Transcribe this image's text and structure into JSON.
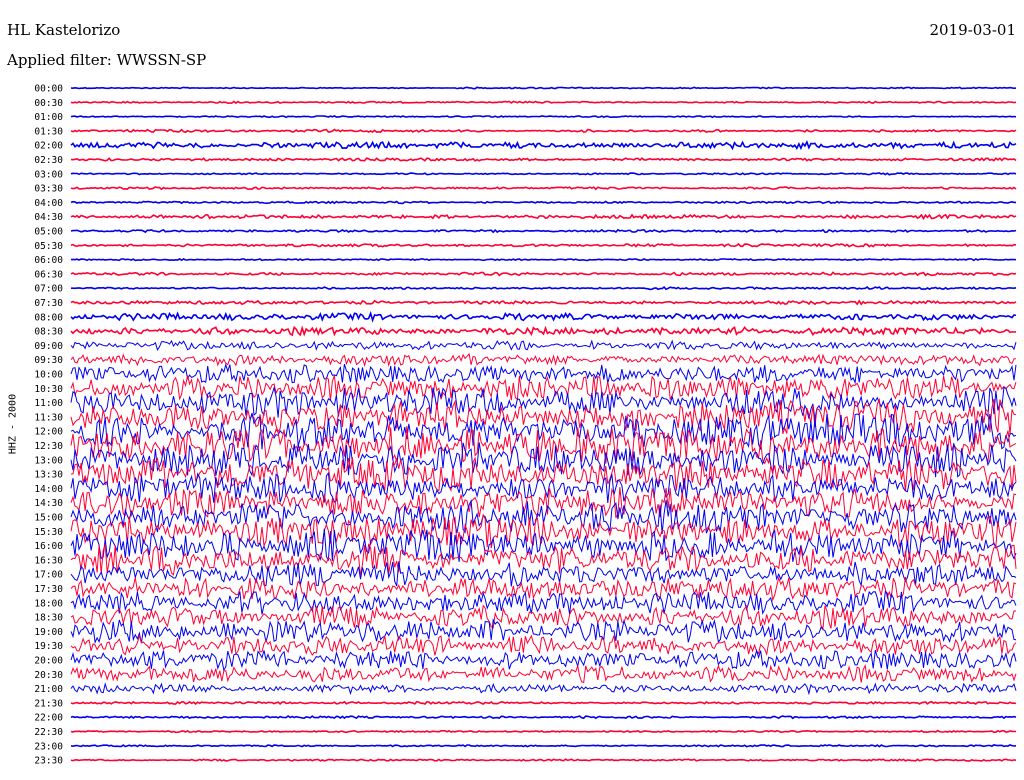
{
  "header": {
    "station": "HL Kastelorizo",
    "date": "2019-03-01",
    "filter": "Applied filter: WWSSN-SP"
  },
  "chart_data": {
    "type": "line",
    "title": "HL Kastelorizo",
    "ylabel": "HHZ - 2000",
    "colors": {
      "odd": "#0000ee",
      "even": "#ff0033"
    },
    "rows": [
      {
        "t": "00:00",
        "amp": 0.5
      },
      {
        "t": "00:30",
        "amp": 0.6
      },
      {
        "t": "01:00",
        "amp": 0.5
      },
      {
        "t": "01:30",
        "amp": 0.9
      },
      {
        "t": "02:00",
        "amp": 2.2
      },
      {
        "t": "02:30",
        "amp": 0.9
      },
      {
        "t": "03:00",
        "amp": 0.6
      },
      {
        "t": "03:30",
        "amp": 0.8
      },
      {
        "t": "04:00",
        "amp": 0.7
      },
      {
        "t": "04:30",
        "amp": 1.3
      },
      {
        "t": "05:00",
        "amp": 0.8
      },
      {
        "t": "05:30",
        "amp": 0.9
      },
      {
        "t": "06:00",
        "amp": 0.6
      },
      {
        "t": "06:30",
        "amp": 1.1
      },
      {
        "t": "07:00",
        "amp": 0.8
      },
      {
        "t": "07:30",
        "amp": 1.2
      },
      {
        "t": "08:00",
        "amp": 2.5
      },
      {
        "t": "08:30",
        "amp": 2.7
      },
      {
        "t": "09:00",
        "amp": 3.2
      },
      {
        "t": "09:30",
        "amp": 4.5
      },
      {
        "t": "10:00",
        "amp": 7
      },
      {
        "t": "10:30",
        "amp": 9
      },
      {
        "t": "11:00",
        "amp": 11
      },
      {
        "t": "11:30",
        "amp": 12
      },
      {
        "t": "12:00",
        "amp": 13
      },
      {
        "t": "12:30",
        "amp": 13
      },
      {
        "t": "13:00",
        "amp": 12
      },
      {
        "t": "13:30",
        "amp": 12
      },
      {
        "t": "14:00",
        "amp": 11
      },
      {
        "t": "14:30",
        "amp": 11
      },
      {
        "t": "15:00",
        "amp": 12
      },
      {
        "t": "15:30",
        "amp": 12
      },
      {
        "t": "16:00",
        "amp": 12
      },
      {
        "t": "16:30",
        "amp": 11
      },
      {
        "t": "17:00",
        "amp": 9
      },
      {
        "t": "17:30",
        "amp": 8
      },
      {
        "t": "18:00",
        "amp": 8
      },
      {
        "t": "18:30",
        "amp": 8
      },
      {
        "t": "19:00",
        "amp": 8
      },
      {
        "t": "19:30",
        "amp": 7
      },
      {
        "t": "20:00",
        "amp": 7
      },
      {
        "t": "20:30",
        "amp": 6
      },
      {
        "t": "21:00",
        "amp": 3.5
      },
      {
        "t": "21:30",
        "amp": 0.9
      },
      {
        "t": "22:00",
        "amp": 0.8
      },
      {
        "t": "22:30",
        "amp": 0.6
      },
      {
        "t": "23:00",
        "amp": 0.6
      },
      {
        "t": "23:30",
        "amp": 0.6
      }
    ]
  }
}
